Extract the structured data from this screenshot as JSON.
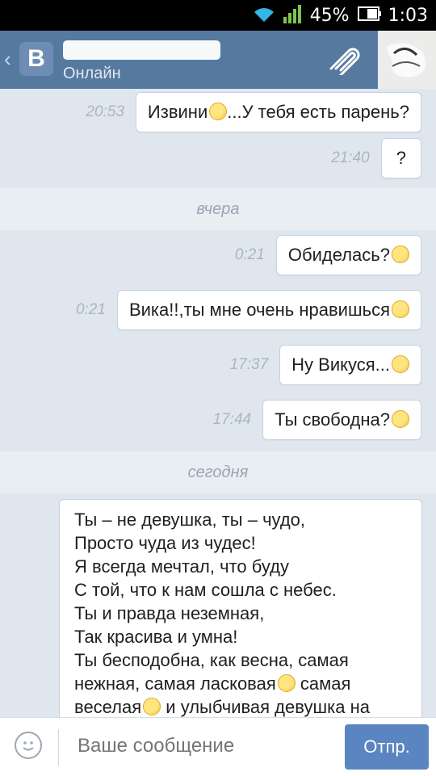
{
  "status_bar": {
    "battery": "45%",
    "time": "1:03"
  },
  "header": {
    "back_glyph": "‹",
    "logo": "В",
    "contact_status": "Онлайн"
  },
  "chat": {
    "messages": [
      {
        "time": "20:53",
        "text": "Извини",
        "emoji": "weary-face",
        "after": "...У тебя есть парень?"
      },
      {
        "time": "21:40",
        "text": "?"
      },
      {
        "divider": "вчера"
      },
      {
        "time": "0:21",
        "text": "Обиделась?",
        "emoji": "crying-face"
      },
      {
        "time": "0:21",
        "text": "Вика!!,ты мне очень нравишься",
        "emoji": "kissing-face"
      },
      {
        "time": "17:37",
        "text": "Ну Викуся...",
        "emoji": "smiling-face"
      },
      {
        "time": "17:44",
        "text": "Ты свободна?",
        "emoji": "kissing-face"
      },
      {
        "divider": "сегодня"
      }
    ],
    "poem_lines": [
      "Ты – не девушка, ты – чудо,",
      "Просто чуда из чудес!",
      "Я всегда мечтал, что буду",
      "С той, что к нам сошла с небес.",
      "Ты и правда неземная,",
      "Так красива и умна!",
      "Ты бесподобна, как весна, самая",
      "нежная, самая ласковая",
      "самая",
      "веселая",
      "и улыбчивая девушка на"
    ]
  },
  "input": {
    "placeholder": "Ваше сообщение",
    "send_label": "Отпр."
  }
}
